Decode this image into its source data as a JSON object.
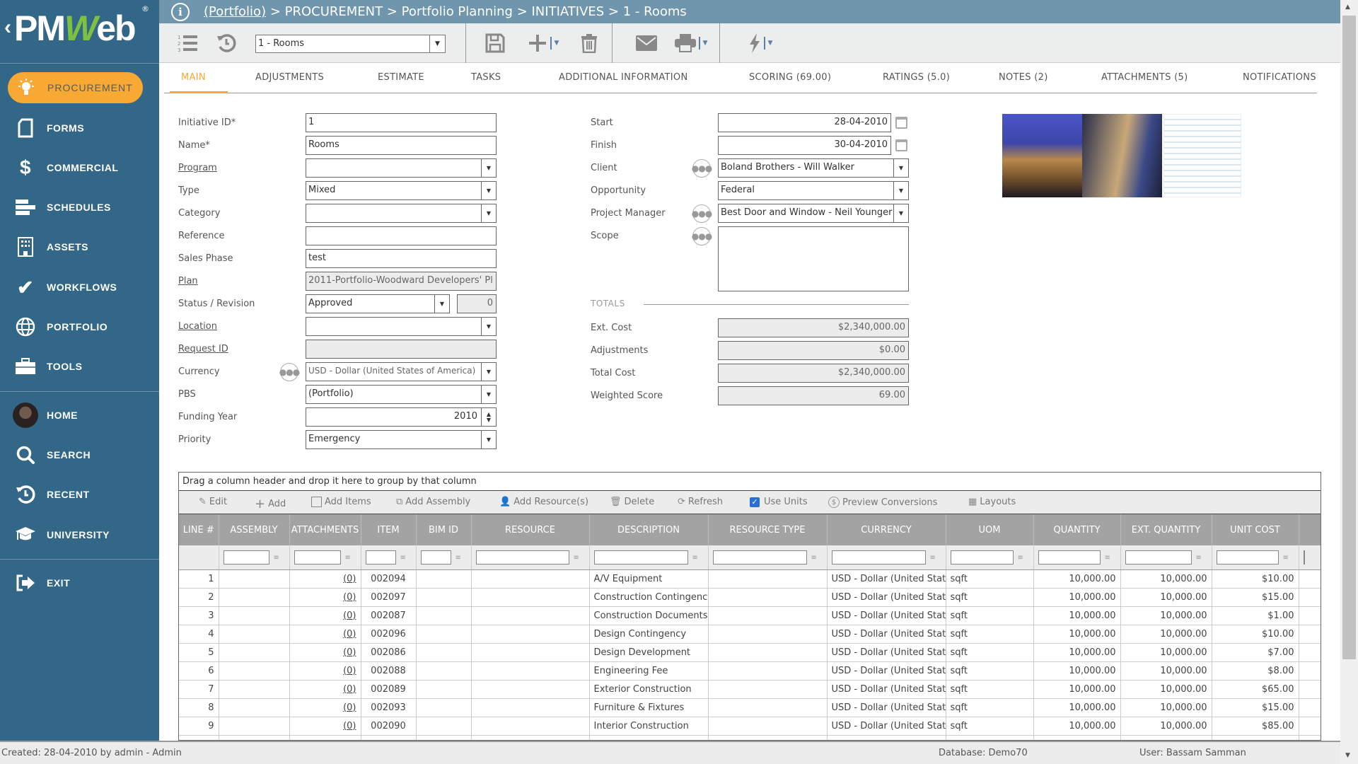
{
  "app": {
    "logo_text": "PMWeb",
    "logo_back": "‹",
    "registered": "®"
  },
  "breadcrumb": {
    "root": "(Portfolio)",
    "rest": " > PROCUREMENT > Portfolio Planning > INITIATIVES > 1 - Rooms"
  },
  "toolbar": {
    "record_select": "1 - Rooms"
  },
  "sidebar": {
    "items": [
      {
        "label": "PROCUREMENT",
        "icon": "lightbulb-icon",
        "glyph": "💡"
      },
      {
        "label": "FORMS",
        "icon": "form-icon",
        "glyph": "▯"
      },
      {
        "label": "COMMERCIAL",
        "icon": "dollar-icon",
        "glyph": "$"
      },
      {
        "label": "SCHEDULES",
        "icon": "schedule-icon",
        "glyph": "☰"
      },
      {
        "label": "ASSETS",
        "icon": "building-icon",
        "glyph": "▦"
      },
      {
        "label": "WORKFLOWS",
        "icon": "check-icon",
        "glyph": "✔"
      },
      {
        "label": "PORTFOLIO",
        "icon": "globe-icon",
        "glyph": "⊕"
      },
      {
        "label": "TOOLS",
        "icon": "toolbox-icon",
        "glyph": "▭"
      },
      {
        "label": "HOME",
        "icon": "avatar",
        "glyph": ""
      },
      {
        "label": "SEARCH",
        "icon": "search-icon",
        "glyph": "⚲"
      },
      {
        "label": "RECENT",
        "icon": "history-icon",
        "glyph": "↺"
      },
      {
        "label": "UNIVERSITY",
        "icon": "graduation-cap-icon",
        "glyph": "🎓"
      },
      {
        "label": "EXIT",
        "icon": "exit-icon",
        "glyph": "⇥"
      }
    ]
  },
  "tabs": [
    "MAIN",
    "ADJUSTMENTS",
    "ESTIMATE",
    "TASKS",
    "ADDITIONAL INFORMATION",
    "SCORING (69.00)",
    "RATINGS (5.0)",
    "NOTES (2)",
    "ATTACHMENTS (5)",
    "NOTIFICATIONS"
  ],
  "form_left": {
    "initiative_id": {
      "label": "Initiative ID*",
      "value": "1"
    },
    "name": {
      "label": "Name*",
      "value": "Rooms"
    },
    "program": {
      "label": "Program",
      "value": ""
    },
    "type": {
      "label": "Type",
      "value": "Mixed"
    },
    "category": {
      "label": "Category",
      "value": ""
    },
    "reference": {
      "label": "Reference",
      "value": ""
    },
    "sales_phase": {
      "label": "Sales Phase",
      "value": "test"
    },
    "plan": {
      "label": "Plan",
      "value": "2011-Portfolio-Woodward Developers' Pl"
    },
    "status": {
      "label": "Status / Revision",
      "value": "Approved",
      "revision": "0"
    },
    "location": {
      "label": "Location",
      "value": ""
    },
    "request_id": {
      "label": "Request ID",
      "value": ""
    },
    "currency": {
      "label": "Currency",
      "value": "USD - Dollar (United States of America)"
    },
    "pbs": {
      "label": "PBS",
      "value": "(Portfolio)"
    },
    "funding_year": {
      "label": "Funding Year",
      "value": "2010"
    },
    "priority": {
      "label": "Priority",
      "value": "Emergency"
    }
  },
  "form_right": {
    "start": {
      "label": "Start",
      "value": "28-04-2010"
    },
    "finish": {
      "label": "Finish",
      "value": "30-04-2010"
    },
    "client": {
      "label": "Client",
      "value": "Boland Brothers - Will Walker"
    },
    "opportunity": {
      "label": "Opportunity",
      "value": "Federal"
    },
    "project_manager": {
      "label": "Project Manager",
      "value": "Best Door and Window - Neil Younger"
    },
    "scope": {
      "label": "Scope",
      "value": ""
    }
  },
  "totals": {
    "heading": "TOTALS",
    "ext_cost": {
      "label": "Ext. Cost",
      "value": "$2,340,000.00"
    },
    "adjustments": {
      "label": "Adjustments",
      "value": "$0.00"
    },
    "total_cost": {
      "label": "Total Cost",
      "value": "$2,340,000.00"
    },
    "weighted_score": {
      "label": "Weighted Score",
      "value": "69.00"
    }
  },
  "grid": {
    "group_hint": "Drag a column header and drop it here to group by that column",
    "toolbar": {
      "edit": "Edit",
      "add": "Add",
      "add_items": "Add Items",
      "add_assembly": "Add Assembly",
      "add_resources": "Add Resource(s)",
      "delete": "Delete",
      "refresh": "Refresh",
      "use_units": "Use Units",
      "preview_conversions": "Preview Conversions",
      "layouts": "Layouts"
    },
    "columns": [
      "LINE #",
      "ASSEMBLY",
      "ATTACHMENTS",
      "ITEM",
      "BIM ID",
      "RESOURCE",
      "DESCRIPTION",
      "RESOURCE TYPE",
      "CURRENCY",
      "UOM",
      "QUANTITY",
      "EXT. QUANTITY",
      "UNIT COST"
    ],
    "rows": [
      {
        "line": "1",
        "assembly": "",
        "attachments": "(0)",
        "item": "002094",
        "bim": "",
        "resource": "",
        "description": "A/V Equipment",
        "resource_type": "",
        "currency": "USD - Dollar (United States of America)",
        "uom": "sqft",
        "quantity": "10,000.00",
        "ext_quantity": "10,000.00",
        "unit_cost": "$10.00"
      },
      {
        "line": "2",
        "assembly": "",
        "attachments": "(0)",
        "item": "002097",
        "bim": "",
        "resource": "",
        "description": "Construction Contingency",
        "resource_type": "",
        "currency": "USD - Dollar (United States of America)",
        "uom": "sqft",
        "quantity": "10,000.00",
        "ext_quantity": "10,000.00",
        "unit_cost": "$15.00"
      },
      {
        "line": "3",
        "assembly": "",
        "attachments": "(0)",
        "item": "002087",
        "bim": "",
        "resource": "",
        "description": "Construction Documents",
        "resource_type": "",
        "currency": "USD - Dollar (United States of America)",
        "uom": "sqft",
        "quantity": "10,000.00",
        "ext_quantity": "10,000.00",
        "unit_cost": "$1.00"
      },
      {
        "line": "4",
        "assembly": "",
        "attachments": "(0)",
        "item": "002096",
        "bim": "",
        "resource": "",
        "description": "Design Contingency",
        "resource_type": "",
        "currency": "USD - Dollar (United States of America)",
        "uom": "sqft",
        "quantity": "10,000.00",
        "ext_quantity": "10,000.00",
        "unit_cost": "$10.00"
      },
      {
        "line": "5",
        "assembly": "",
        "attachments": "(0)",
        "item": "002086",
        "bim": "",
        "resource": "",
        "description": "Design Development",
        "resource_type": "",
        "currency": "USD - Dollar (United States of America)",
        "uom": "sqft",
        "quantity": "10,000.00",
        "ext_quantity": "10,000.00",
        "unit_cost": "$7.00"
      },
      {
        "line": "6",
        "assembly": "",
        "attachments": "(0)",
        "item": "002088",
        "bim": "",
        "resource": "",
        "description": "Engineering Fee",
        "resource_type": "",
        "currency": "USD - Dollar (United States of America)",
        "uom": "sqft",
        "quantity": "10,000.00",
        "ext_quantity": "10,000.00",
        "unit_cost": "$8.00"
      },
      {
        "line": "7",
        "assembly": "",
        "attachments": "(0)",
        "item": "002089",
        "bim": "",
        "resource": "",
        "description": "Exterior Construction",
        "resource_type": "",
        "currency": "USD - Dollar (United States of America)",
        "uom": "sqft",
        "quantity": "10,000.00",
        "ext_quantity": "10,000.00",
        "unit_cost": "$65.00"
      },
      {
        "line": "8",
        "assembly": "",
        "attachments": "(0)",
        "item": "002093",
        "bim": "",
        "resource": "",
        "description": "Furniture & Fixtures",
        "resource_type": "",
        "currency": "USD - Dollar (United States of America)",
        "uom": "sqft",
        "quantity": "10,000.00",
        "ext_quantity": "10,000.00",
        "unit_cost": "$15.00"
      },
      {
        "line": "9",
        "assembly": "",
        "attachments": "(0)",
        "item": "002090",
        "bim": "",
        "resource": "",
        "description": "Interior Construction",
        "resource_type": "",
        "currency": "USD - Dollar (United States of America)",
        "uom": "sqft",
        "quantity": "10,000.00",
        "ext_quantity": "10,000.00",
        "unit_cost": "$85.00"
      }
    ]
  },
  "status_bar": {
    "created": "Created:  28-04-2010 by admin - Admin",
    "database": "Database:   Demo70",
    "user": "User:  Bassam Samman"
  },
  "colors": {
    "sidebar": "#336787",
    "accent": "#f7a934",
    "topbar": "#7096ad",
    "grid_header": "#a3a3a3"
  }
}
